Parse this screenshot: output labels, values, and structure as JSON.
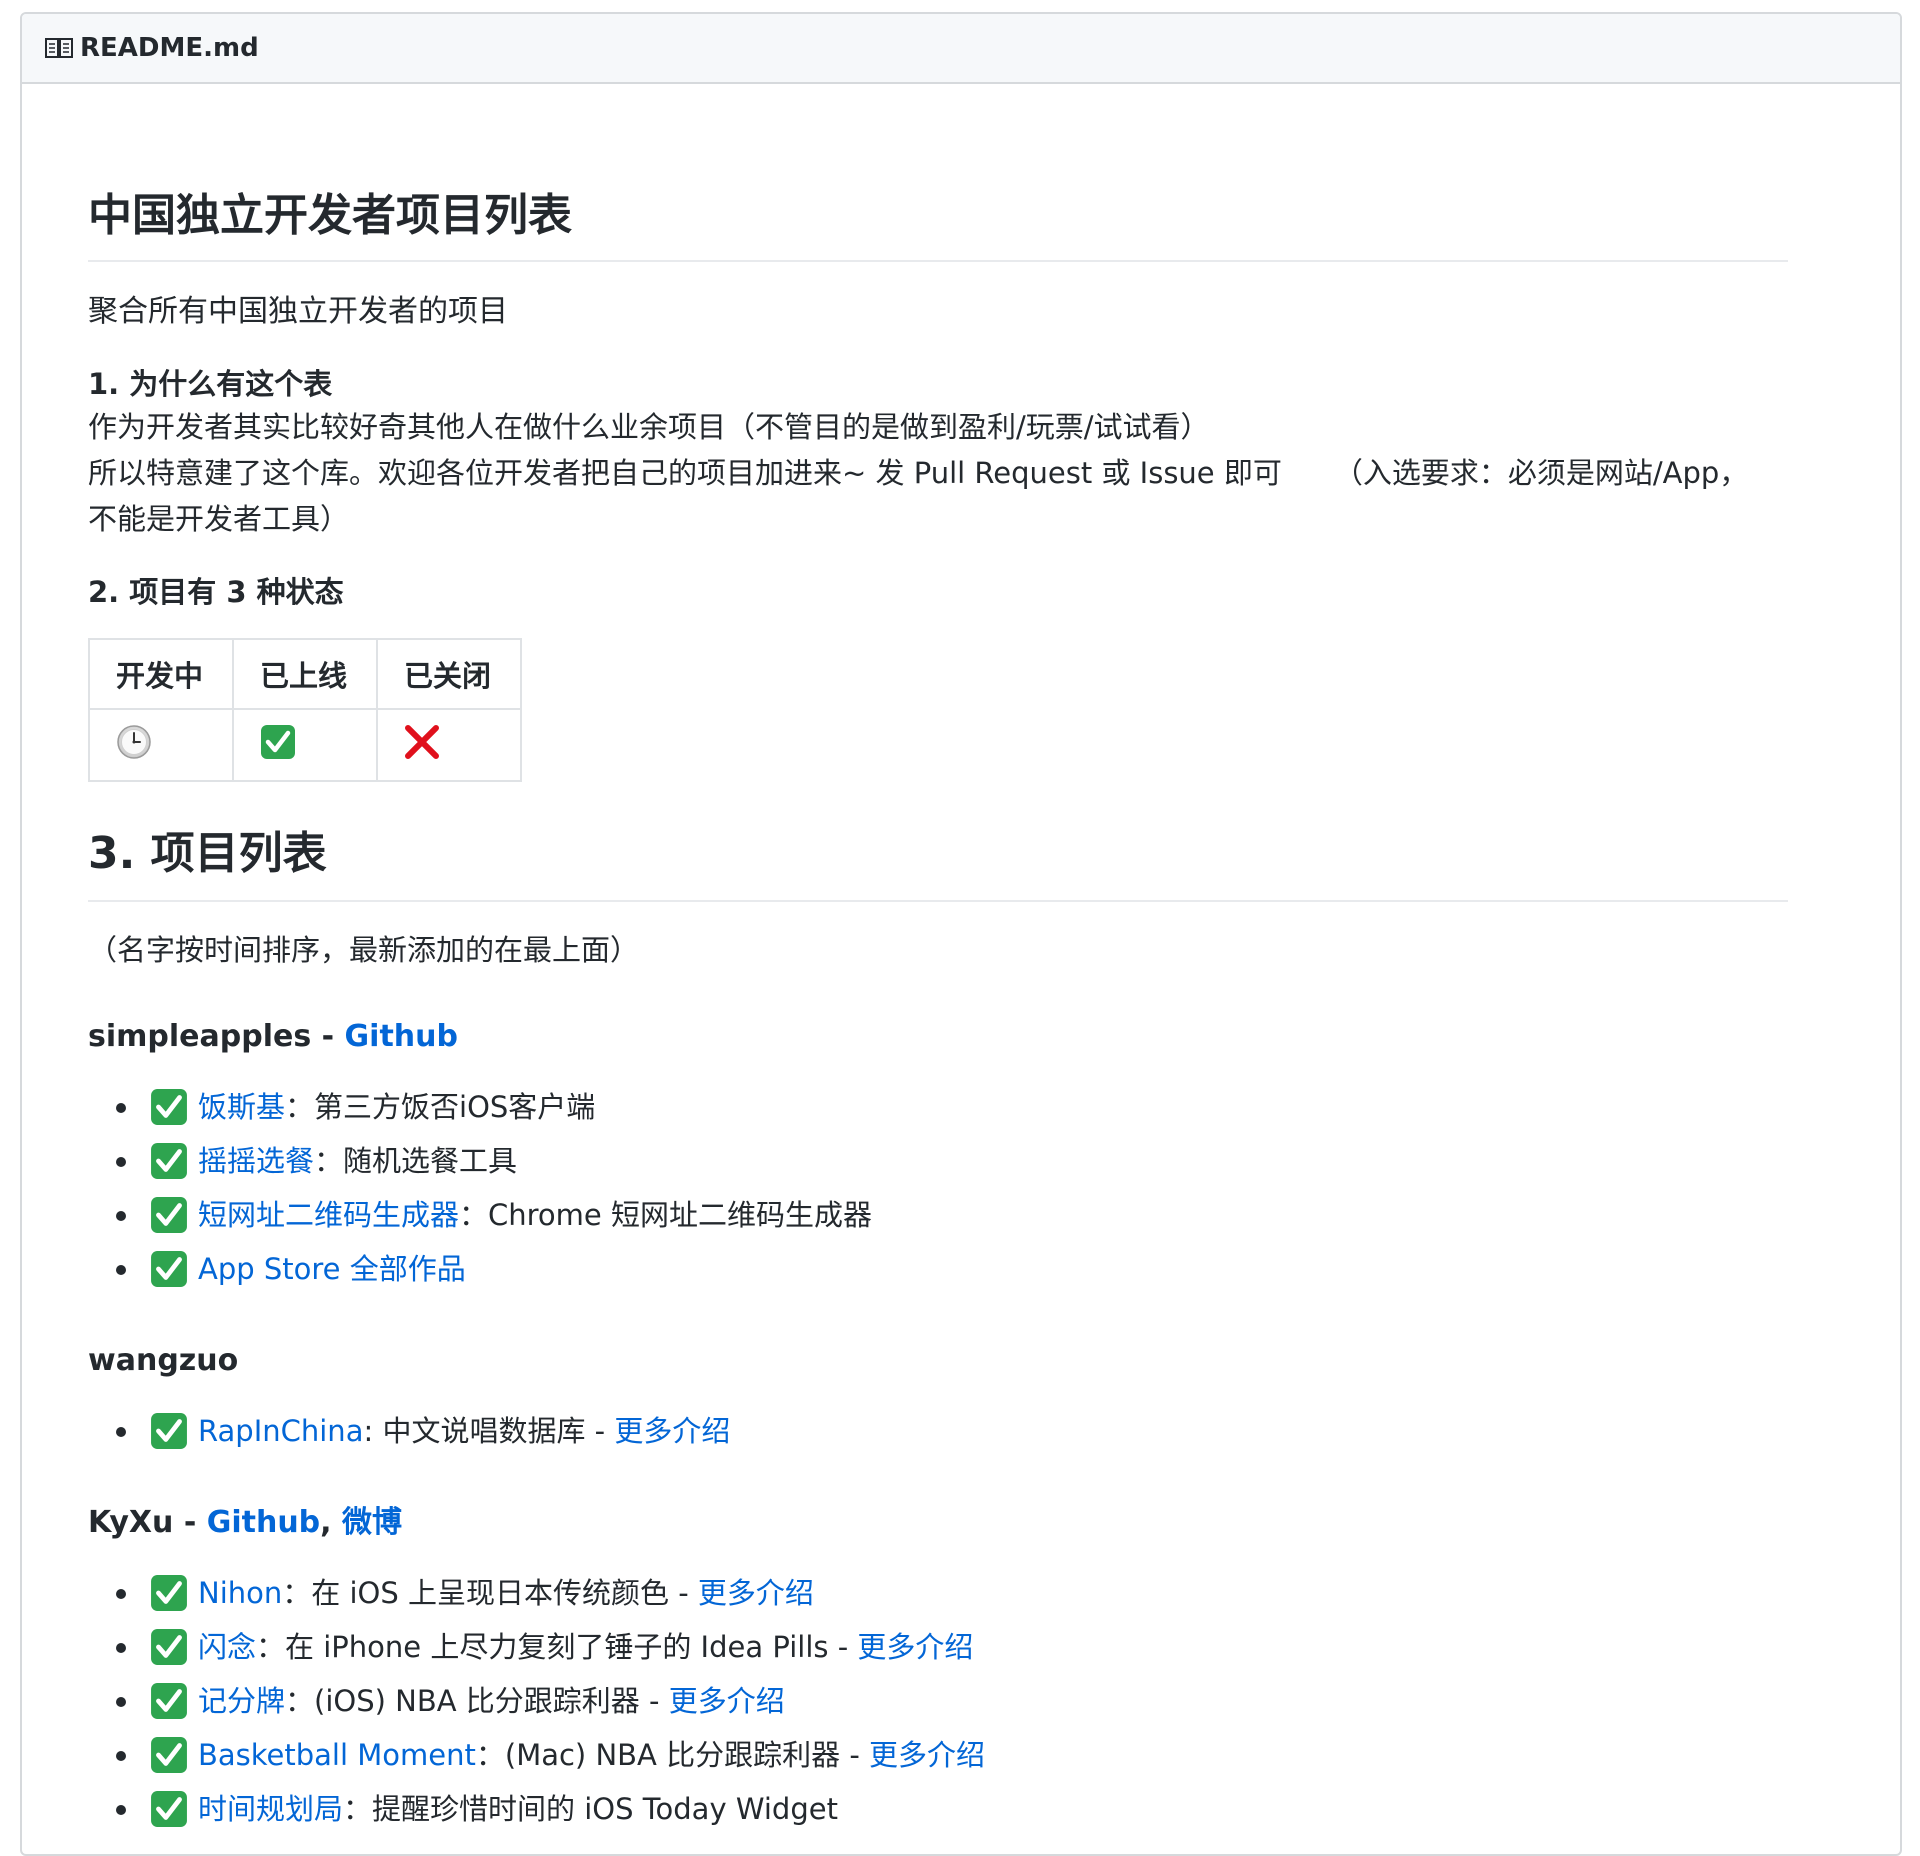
{
  "file_header": {
    "icon": "book-icon",
    "filename": "README.md"
  },
  "title": "中国独立开发者项目列表",
  "subtitle": "聚合所有中国独立开发者的项目",
  "section1": {
    "heading": "1. 为什么有这个表",
    "line1": "作为开发者其实比较好奇其他人在做什么业余项目（不管目的是做到盈利/玩票/试试看）",
    "line2a": "所以特意建了这个库。欢迎各位开发者把自己的项目加进来~ 发 Pull Request 或 Issue 即可",
    "line2b": "（入选要求：必须是网站/App，",
    "line3": "不能是开发者工具）"
  },
  "section2": {
    "heading": "2. 项目有 3 种状态",
    "headers": [
      "开发中",
      "已上线",
      "已关闭"
    ],
    "icons": [
      "clock-icon",
      "check-icon",
      "cross-icon"
    ]
  },
  "section3": {
    "heading": "3. 项目列表",
    "note": "（名字按时间排序，最新添加的在最上面）"
  },
  "authors": [
    {
      "name": "simpleapples",
      "sep": " - ",
      "links": [
        "Github"
      ],
      "items": [
        {
          "link": "饭斯基",
          "desc": "：第三方饭否iOS客户端"
        },
        {
          "link": "摇摇选餐",
          "desc": "：随机选餐工具"
        },
        {
          "link": "短网址二维码生成器",
          "desc": "：Chrome 短网址二维码生成器"
        },
        {
          "link": "App Store 全部作品",
          "desc": ""
        }
      ]
    },
    {
      "name": "wangzuo",
      "items": [
        {
          "link": "RapInChina",
          "desc": ": 中文说唱数据库 - ",
          "more": "更多介绍"
        }
      ]
    },
    {
      "name": "KyXu",
      "sep": " - ",
      "links": [
        "Github",
        "微博"
      ],
      "items": [
        {
          "link": "Nihon",
          "desc": "：在 iOS 上呈现日本传统颜色 - ",
          "more": "更多介绍"
        },
        {
          "link": "闪念",
          "desc": "：在 iPhone 上尽力复刻了锤子的 Idea Pills - ",
          "more": "更多介绍"
        },
        {
          "link": "记分牌",
          "desc": "：(iOS) NBA 比分跟踪利器 - ",
          "more": "更多介绍"
        },
        {
          "link": "Basketball Moment",
          "desc": "：(Mac) NBA 比分跟踪利器 - ",
          "more": "更多介绍"
        },
        {
          "link": "时间规划局",
          "desc": "：提醒珍惜时间的 iOS Today Widget"
        }
      ]
    }
  ],
  "colors": {
    "link": "#0366d6",
    "check_green": "#2ea44f",
    "cross_red": "#e0101c",
    "border": "#d6d9dc"
  }
}
